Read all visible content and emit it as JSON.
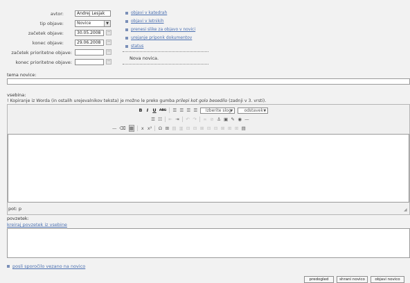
{
  "form": {
    "author_label": "avtor:",
    "author_value": "Andrej Lesjak",
    "type_label": "tip objave:",
    "type_value": "Novice",
    "start_label": "začetek objave:",
    "start_value": "30.05.2008",
    "end_label": "konec objave:",
    "end_value": "29.06.2008",
    "priority_start_label": "začetek prioritetne objave:",
    "priority_start_value": "",
    "priority_end_label": "konec prioritetne objave:",
    "priority_end_value": ""
  },
  "links": [
    "objavi v katedrah",
    "objavi v letnikih",
    "prenesi slike za objavo v novici",
    "urejanje priponk dokumentov",
    "status"
  ],
  "status_text": "Nova novica.",
  "title_label": "tema novice:",
  "content_label": "vsebina:",
  "hint_prefix": "! Kopiranje iz Worda (in ostalih urejevalnikov teksta) je možno le preko gumba ",
  "hint_em": "prilepi kot golo besedilo",
  "hint_suffix": " (zadnji v 3. vrsti).",
  "editor": {
    "style_select": "Izberite slog",
    "format_select": "odstavek",
    "path": "pot: p"
  },
  "summary_label": "povzetek:",
  "summary_link": "kreiraj povzetek iz vsebine",
  "bottom_link": "posli sporočilo vezano na novico",
  "buttons": {
    "preview": "predogled",
    "save": "shrani novico",
    "publish": "objavi novico"
  },
  "icons": {
    "bold": "B",
    "italic": "I",
    "underline": "U",
    "strike": "ABC",
    "bullets": "☰",
    "numbered": "☷",
    "omega": "Ω",
    "subscript": "x",
    "superscript": "x²"
  }
}
